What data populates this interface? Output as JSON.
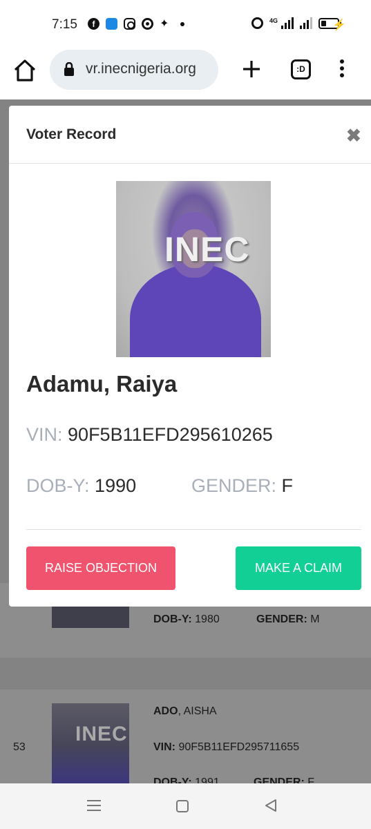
{
  "status_bar": {
    "time": "7:15",
    "network": "4G"
  },
  "browser": {
    "url": "vr.inecnigeria.org",
    "tabs_label": ":D"
  },
  "modal": {
    "title": "Voter Record",
    "close_icon": "close-icon",
    "photo_watermark": "INEC",
    "name": "Adamu, Raiya",
    "vin_label": "VIN:",
    "vin_value": "90F5B11EFD295610265",
    "dob_label": "DOB-Y:",
    "dob_value": "1990",
    "gender_label": "GENDER:",
    "gender_value": "F",
    "objection_button": "RAISE OBJECTION",
    "claim_button": "MAKE A CLAIM",
    "colors": {
      "objection": "#f0536d",
      "claim": "#12cf95"
    }
  },
  "background_list": {
    "record_1": {
      "dob_label": "DOB-Y:",
      "dob_value": "1980",
      "gender_label": "GENDER:",
      "gender_value": "M"
    },
    "record_2": {
      "number": "53",
      "surname": "ADO",
      "given_name": ", AISHA",
      "vin_label": "VIN:",
      "vin_value": "90F5B11EFD295711655",
      "dob_label": "DOB-Y:",
      "dob_value": "1991",
      "gender_label": "GENDER:",
      "gender_value": "F",
      "photo_watermark": "INEC"
    }
  }
}
